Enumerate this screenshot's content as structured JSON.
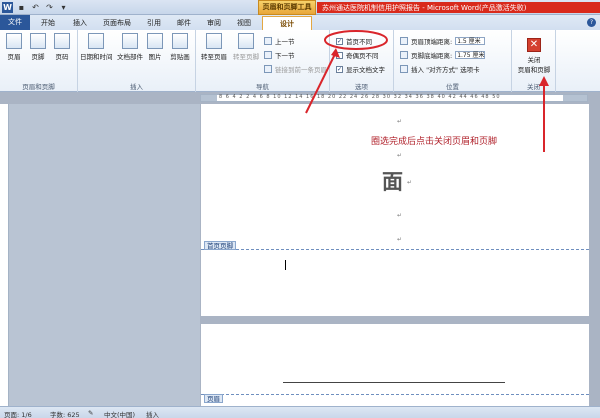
{
  "window": {
    "app_icon": "W",
    "context_tools": "页眉和页脚工具",
    "title": "苏州通达医院机制信用护照报告  -  Microsoft Word(产品激活失败)",
    "help_icon": "?"
  },
  "qat": [
    "save-icon",
    "undo-icon",
    "redo-icon",
    "customize-icon"
  ],
  "tabs": [
    {
      "label": "文件"
    },
    {
      "label": "开始"
    },
    {
      "label": "插入"
    },
    {
      "label": "页面布局"
    },
    {
      "label": "引用"
    },
    {
      "label": "邮件"
    },
    {
      "label": "审阅"
    },
    {
      "label": "视图"
    },
    {
      "label": "设计"
    }
  ],
  "ribbon": {
    "header_footer": {
      "label": "页眉和页脚",
      "header": "页眉",
      "footer": "页脚",
      "page_number": "页码"
    },
    "insert": {
      "label": "插入",
      "date_time": "日期和时间",
      "doc_parts": "文档部件",
      "picture": "图片",
      "clip_art": "剪贴画"
    },
    "navigation": {
      "label": "导航",
      "goto_header": "转至页眉",
      "goto_footer": "转至页脚",
      "prev_section": "上一节",
      "next_section": "下一节",
      "link_previous": "链接到前一条页眉"
    },
    "options": {
      "label": "选项",
      "first_page_diff": "首页不同",
      "odd_even_diff": "奇偶页不同",
      "show_doc_text": "显示文档文字",
      "first_page_checked": "✓",
      "show_text_checked": "✓"
    },
    "position": {
      "label": "位置",
      "header_top": "页眉顶端距离:",
      "header_top_value": "1.5 厘米",
      "footer_bottom": "页脚底端距离:",
      "footer_bottom_value": "1.75 厘米",
      "insert_align_tab": "插入 \"对齐方式\" 选项卡"
    },
    "close": {
      "label": "关闭",
      "close_btn": "关闭",
      "close_btn_2": "页眉和页脚",
      "close_icon": "✕"
    }
  },
  "ruler": {
    "numbers": "8  6  4  2    2  4  6  8  10  12  14  16  18  20  22  24  26  28  30  32  34  36  38  40  42  44  46  48  50"
  },
  "document": {
    "annotation": "圈选完成后点击关闭页眉和页脚",
    "big_char": "面",
    "para_mark": "↵",
    "first_page_footer_label": "首页页脚",
    "header_label": "页眉"
  },
  "statusbar": {
    "page": "页面: 1/6",
    "words": "字数: 625",
    "language": "中文(中国)",
    "mode": "插入"
  },
  "colors": {
    "annotation": "#b0202a",
    "arrow": "#d9252b",
    "word_blue": "#2b579a"
  }
}
